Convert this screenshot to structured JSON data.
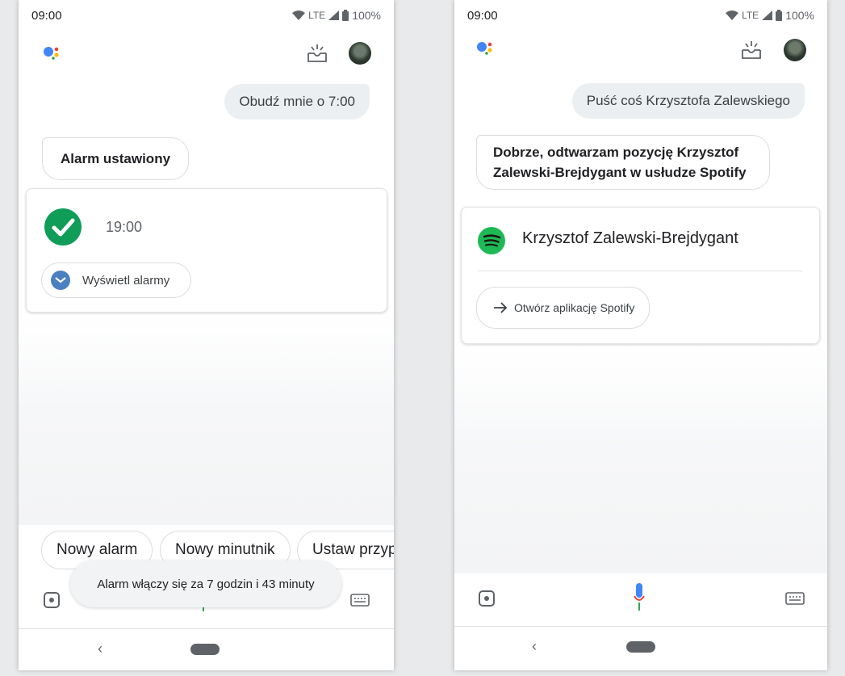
{
  "colors": {
    "assistant_blue": "#4285f4",
    "assistant_red": "#ea4335",
    "assistant_yellow": "#fbbc05",
    "assistant_green": "#34a853",
    "check_green": "#0f9d58",
    "spotify_green": "#1db954"
  },
  "phone1": {
    "status": {
      "time": "09:00",
      "network": "LTE",
      "battery": "100%"
    },
    "user_message": "Obudź mnie o 7:00",
    "assistant_message": "Alarm ustawiony",
    "alarm_card": {
      "time": "19:00",
      "icon": "check-circle-icon",
      "view_button": "Wyświetl alarmy"
    },
    "suggestions": [
      "Nowy alarm",
      "Nowy minutnik",
      "Ustaw przyp"
    ],
    "toast": "Alarm włączy się za 7 godzin i 43 minuty",
    "nav": {
      "back": "‹"
    }
  },
  "phone2": {
    "status": {
      "time": "09:00",
      "network": "LTE",
      "battery": "100%"
    },
    "user_message": "Puść coś Krzysztofa Zalewskiego",
    "assistant_message": "Dobrze, odtwarzam pozycję Krzysztof Zalewski-Brejdygant w usłudze Spotify",
    "spotify_card": {
      "title": "Krzysztof Zalewski-Brejdygant",
      "icon": "spotify-icon",
      "open_button": "Otwórz aplikację Spotify"
    },
    "nav": {
      "back": "‹"
    }
  }
}
